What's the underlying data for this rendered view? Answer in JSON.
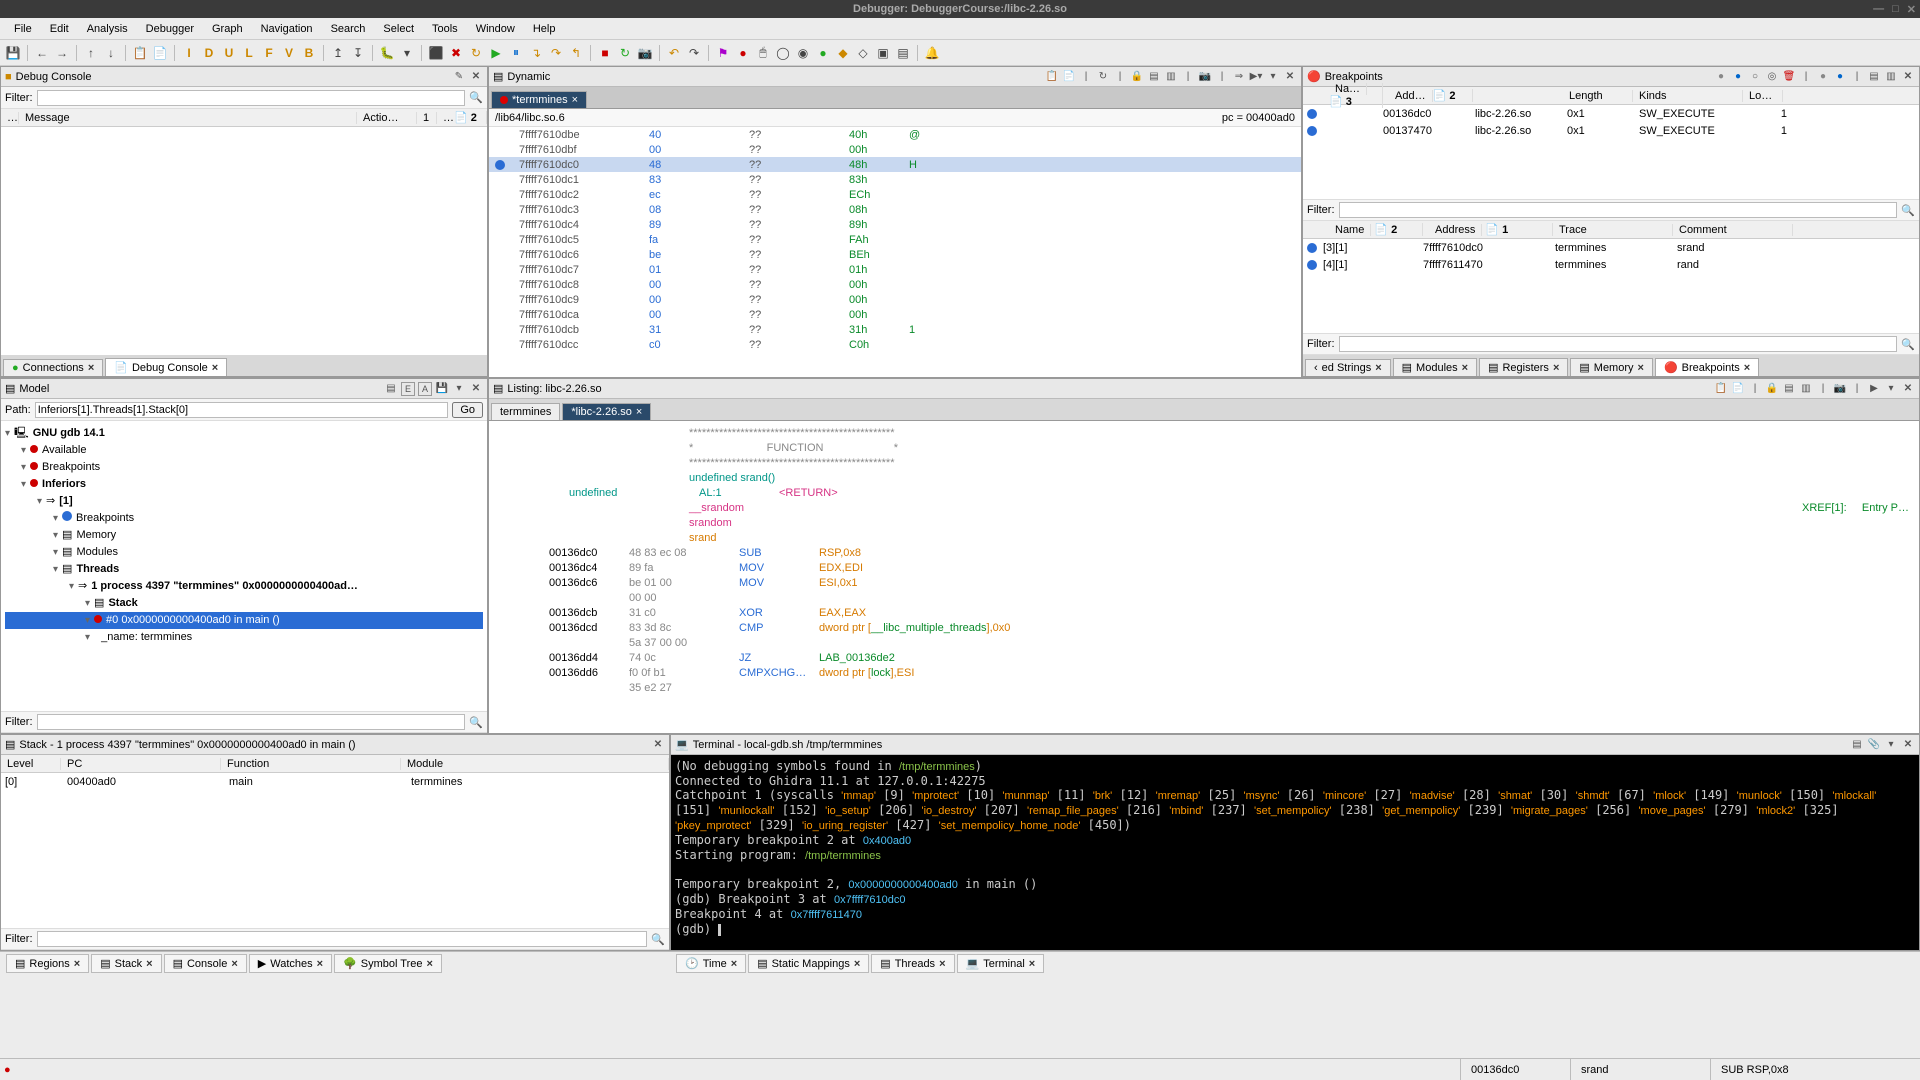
{
  "window": {
    "title": "Debugger: DebuggerCourse:/libc-2.26.so"
  },
  "menu": [
    "File",
    "Edit",
    "Analysis",
    "Debugger",
    "Graph",
    "Navigation",
    "Search",
    "Select",
    "Tools",
    "Window",
    "Help"
  ],
  "debugConsole": {
    "title": "Debug Console",
    "filter_label": "Filter:",
    "cols": {
      "msg": "Message",
      "actions": "Actio…",
      "c1": "1",
      "c2": "2"
    },
    "conn_tab": "Connections",
    "dc_tab": "Debug Console"
  },
  "model": {
    "title": "Model",
    "path_label": "Path:",
    "path_value": "Inferiors[1].Threads[1].Stack[0]",
    "go": "Go",
    "tree": [
      {
        "lv": 0,
        "icon": "proc",
        "label": "GNU gdb 14.1",
        "bold": true
      },
      {
        "lv": 1,
        "icon": "red",
        "label": "Available"
      },
      {
        "lv": 1,
        "icon": "red",
        "label": "Breakpoints"
      },
      {
        "lv": 1,
        "icon": "red",
        "label": "Inferiors",
        "bold": true
      },
      {
        "lv": 2,
        "icon": "arrow",
        "label": "[1]",
        "bold": true
      },
      {
        "lv": 3,
        "icon": "blue",
        "label": "Breakpoints"
      },
      {
        "lv": 3,
        "icon": "mem",
        "label": "Memory"
      },
      {
        "lv": 3,
        "icon": "mod",
        "label": "Modules"
      },
      {
        "lv": 3,
        "icon": "thr",
        "label": "Threads",
        "bold": true
      },
      {
        "lv": 4,
        "icon": "arrow",
        "label": "1    process 4397 \"termmines\" 0x0000000000400ad…",
        "bold": true
      },
      {
        "lv": 5,
        "icon": "stack",
        "label": "Stack",
        "bold": true
      },
      {
        "lv": 5,
        "icon": "red",
        "label": "#0   0x0000000000400ad0 in main ()",
        "sel": true
      },
      {
        "lv": 5,
        "icon": "none",
        "label": "_name: termmines"
      }
    ]
  },
  "dynamic": {
    "title": "Dynamic",
    "tab": "*termmines",
    "path": "/lib64/libc.so.6",
    "pc": "pc = 00400ad0",
    "rows": [
      {
        "a": "7ffff7610dbe",
        "b": "40",
        "q": "??",
        "v": "40h",
        "c": "@"
      },
      {
        "a": "7ffff7610dbf",
        "b": "00",
        "q": "??",
        "v": "00h",
        "c": ""
      },
      {
        "a": "7ffff7610dc0",
        "b": "48",
        "q": "??",
        "v": "48h",
        "c": "H",
        "hl": true,
        "bp": true
      },
      {
        "a": "7ffff7610dc1",
        "b": "83",
        "q": "??",
        "v": "83h",
        "c": ""
      },
      {
        "a": "7ffff7610dc2",
        "b": "ec",
        "q": "??",
        "v": "ECh",
        "c": ""
      },
      {
        "a": "7ffff7610dc3",
        "b": "08",
        "q": "??",
        "v": "08h",
        "c": ""
      },
      {
        "a": "7ffff7610dc4",
        "b": "89",
        "q": "??",
        "v": "89h",
        "c": ""
      },
      {
        "a": "7ffff7610dc5",
        "b": "fa",
        "q": "??",
        "v": "FAh",
        "c": ""
      },
      {
        "a": "7ffff7610dc6",
        "b": "be",
        "q": "??",
        "v": "BEh",
        "c": ""
      },
      {
        "a": "7ffff7610dc7",
        "b": "01",
        "q": "??",
        "v": "01h",
        "c": ""
      },
      {
        "a": "7ffff7610dc8",
        "b": "00",
        "q": "??",
        "v": "00h",
        "c": ""
      },
      {
        "a": "7ffff7610dc9",
        "b": "00",
        "q": "??",
        "v": "00h",
        "c": ""
      },
      {
        "a": "7ffff7610dca",
        "b": "00",
        "q": "??",
        "v": "00h",
        "c": ""
      },
      {
        "a": "7ffff7610dcb",
        "b": "31",
        "q": "??",
        "v": "31h",
        "c": "1"
      },
      {
        "a": "7ffff7610dcc",
        "b": "c0",
        "q": "??",
        "v": "C0h",
        "c": ""
      }
    ]
  },
  "listing": {
    "title": "Listing:   libc-2.26.so",
    "tabs": [
      "termmines",
      "*libc-2.26.so"
    ],
    "func_banner": "FUNCTION",
    "ret": "undefined",
    "ret2": "AL:1",
    "ret3": "<RETURN>",
    "sym1": "__srandom",
    "sym2": "srandom",
    "sym3": "srand",
    "xref": "XREF[1]:     Entry P…",
    "decl": "undefined srand()",
    "rows": [
      {
        "a": "00136dc0",
        "b": "48 83 ec 08",
        "m": "SUB",
        "op": "RSP,0x8",
        "bp": true
      },
      {
        "a": "00136dc4",
        "b": "89 fa",
        "m": "MOV",
        "op": "EDX,EDI"
      },
      {
        "a": "00136dc6",
        "b": "be 01 00",
        "m": "MOV",
        "op": "ESI,0x1"
      },
      {
        "a": "",
        "b": "00 00",
        "m": "",
        "op": ""
      },
      {
        "a": "00136dcb",
        "b": "31 c0",
        "m": "XOR",
        "op": "EAX,EAX"
      },
      {
        "a": "00136dcd",
        "b": "83 3d 8c",
        "m": "CMP",
        "op": "dword ptr [__libc_multiple_threads],0x0",
        "link": true
      },
      {
        "a": "",
        "b": "5a 37 00 00",
        "m": "",
        "op": ""
      },
      {
        "a": "00136dd4",
        "b": "74 0c",
        "m": "JZ",
        "op": "LAB_00136de2",
        "oplink": true
      },
      {
        "a": "00136dd6",
        "b": "f0 0f b1",
        "m": "CMPXCHG…",
        "op": "dword ptr [lock],ESI",
        "link": true
      },
      {
        "a": "",
        "b": "35 e2 27",
        "m": "",
        "op": ""
      }
    ]
  },
  "breakpoints": {
    "title": "Breakpoints",
    "cols": [
      "",
      "Na…",
      "3",
      "Add…",
      "2",
      "",
      "Length",
      "Kinds",
      "Lo…",
      ""
    ],
    "rows": [
      {
        "addr": "00136dc0",
        "img": "libc-2.26.so",
        "len": "0x1",
        "kind": "SW_EXECUTE",
        "loc": "1"
      },
      {
        "addr": "00137470",
        "img": "libc-2.26.so",
        "len": "0x1",
        "kind": "SW_EXECUTE",
        "loc": "1"
      }
    ],
    "cols2": [
      "",
      "Name",
      "2",
      "Address",
      "1",
      "Trace",
      "Comment",
      ""
    ],
    "rows2": [
      {
        "id": "[3][1]",
        "addr": "7ffff7610dc0",
        "trace": "termmines",
        "cmt": "srand"
      },
      {
        "id": "[4][1]",
        "addr": "7ffff7611470",
        "trace": "termmines",
        "cmt": "rand"
      }
    ],
    "filter_label": "Filter:"
  },
  "stack": {
    "title": "Stack - 1    process 4397 \"termmines\" 0x0000000000400ad0 in main ()",
    "cols": [
      "Level",
      "PC",
      "Function",
      "Module"
    ],
    "row": {
      "level": "[0]",
      "pc": "00400ad0",
      "fn": "main",
      "mod": "termmines"
    }
  },
  "terminal": {
    "title": "Terminal - local-gdb.sh /tmp/termmines",
    "lines": [
      "(No debugging symbols found in /tmp/termmines)",
      "Connected to Ghidra 11.1 at 127.0.0.1:42275",
      "Catchpoint 1 (syscalls 'mmap' [9] 'mprotect' [10] 'munmap' [11] 'brk' [12] 'mremap' [25] 'msync' [26] 'mincore' [27] 'madvise' [28] 'shmat' [30] 'shmdt' [67] 'mlock' [149] 'munlock' [150] 'mlockall' [151] 'munlockall' [152] 'io_setup' [206] 'io_destroy' [207] 'remap_file_pages' [216] 'mbind' [237] 'set_mempolicy' [238] 'get_mempolicy' [239] 'migrate_pages' [256] 'move_pages' [279] 'mlock2' [325] 'pkey_mprotect' [329] 'io_uring_register' [427] 'set_mempolicy_home_node' [450])",
      "Temporary breakpoint 2 at 0x400ad0",
      "Starting program: /tmp/termmines",
      "",
      "Temporary breakpoint 2, 0x0000000000400ad0 in main ()",
      "(gdb) Breakpoint 3 at 0x7ffff7610dc0",
      "Breakpoint 4 at 0x7ffff7611470",
      "(gdb) "
    ]
  },
  "bottomTabsLeft": [
    "Regions",
    "Stack",
    "Console",
    "Watches",
    "Symbol Tree"
  ],
  "bottomTabsRight": [
    "Time",
    "Static Mappings",
    "Threads",
    "Terminal"
  ],
  "sideTabs": [
    "ed Strings",
    "Modules",
    "Registers",
    "Memory",
    "Breakpoints"
  ],
  "status": {
    "addr": "00136dc0",
    "sym": "srand",
    "ins": "SUB RSP,0x8"
  }
}
